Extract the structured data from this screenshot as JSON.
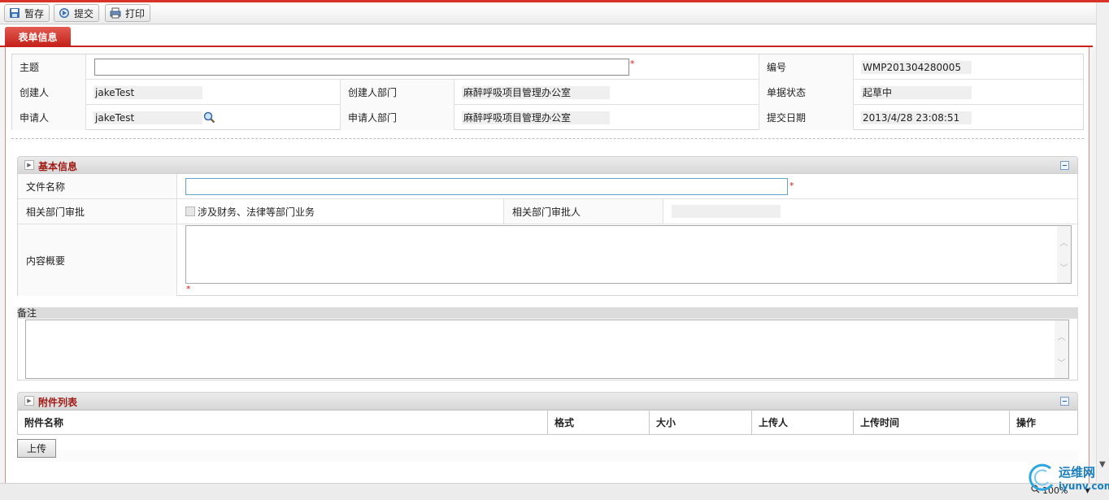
{
  "toolbar": {
    "save_label": "暂存",
    "submit_label": "提交",
    "print_label": "打印"
  },
  "tab": {
    "label": "表单信息"
  },
  "header": {
    "subject_label": "主题",
    "subject_value": "",
    "number_label": "编号",
    "number_value": "WMP201304280005",
    "creator_label": "创建人",
    "creator_value": "jakeTest",
    "creator_dept_label": "创建人部门",
    "creator_dept_value": "麻醉呼吸项目管理办公室",
    "status_label": "单据状态",
    "status_value": "起草中",
    "applicant_label": "申请人",
    "applicant_value": "jakeTest",
    "applicant_dept_label": "申请人部门",
    "applicant_dept_value": "麻醉呼吸项目管理办公室",
    "submit_date_label": "提交日期",
    "submit_date_value": "2013/4/28 23:08:51",
    "required_mark": "*"
  },
  "basic": {
    "title": "基本信息",
    "file_name_label": "文件名称",
    "file_name_value": "",
    "dept_approval_label": "相关部门审批",
    "dept_approval_checkbox_label": "涉及财务、法律等部门业务",
    "dept_approver_label": "相关部门审批人",
    "dept_approver_value": "",
    "summary_label": "内容概要",
    "summary_value": ""
  },
  "remark": {
    "label": "备注",
    "value": ""
  },
  "attachments": {
    "title": "附件列表",
    "columns": [
      "附件名称",
      "格式",
      "大小",
      "上传人",
      "上传时间",
      "操作"
    ],
    "upload_label": "上传"
  },
  "statusbar": {
    "zoom": "100%"
  },
  "watermark": {
    "line1": "运维网",
    "line2": "iyunv.com"
  }
}
